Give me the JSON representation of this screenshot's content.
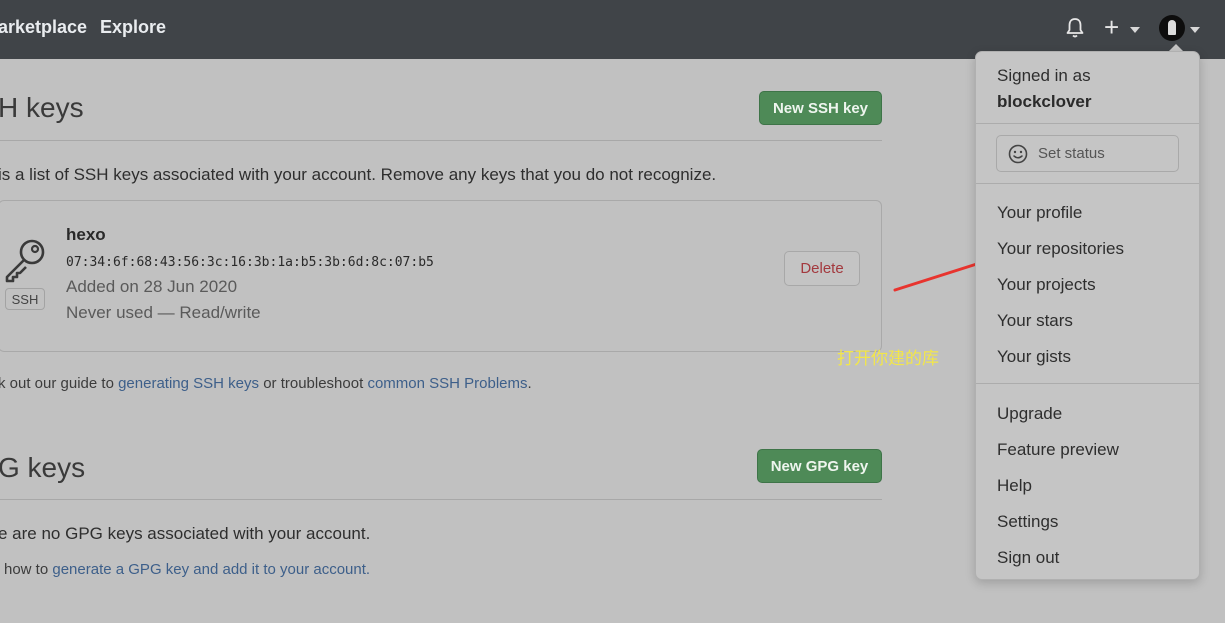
{
  "nav": {
    "marketplace": "arketplace",
    "explore": "Explore"
  },
  "ssh": {
    "heading": "H keys",
    "new_button": "New SSH key",
    "description": "is a list of SSH keys associated with your account. Remove any keys that you do not recognize.",
    "key": {
      "title": "hexo",
      "fingerprint": "07:34:6f:68:43:56:3c:16:3b:1a:b5:3b:6d:8c:07:b5",
      "added": "Added on 28 Jun 2020",
      "usage": "Never used — Read/write",
      "badge": "SSH",
      "delete_label": "Delete"
    },
    "guide_prefix": "k out our guide to",
    "guide_link1": "generating SSH keys",
    "guide_middle": "or troubleshoot",
    "guide_link2": "common SSH Problems",
    "guide_suffix": "."
  },
  "gpg": {
    "heading": "G keys",
    "new_button": "New GPG key",
    "empty_text": "e are no GPG keys associated with your account.",
    "learn_prefix": "how to",
    "learn_link": "generate a GPG key and add it to your account."
  },
  "dropdown": {
    "signed_in_label": "Signed in as",
    "username": "blockclover",
    "set_status": "Set status",
    "items": [
      "Your profile",
      "Your repositories",
      "Your projects",
      "Your stars",
      "Your gists"
    ],
    "items2": [
      "Upgrade",
      "Feature preview",
      "Help",
      "Settings",
      "Sign out"
    ]
  },
  "annotation": {
    "text": "打开你建的库"
  },
  "colors": {
    "topbar": "#404448",
    "green_button": "#4e8a57",
    "arrow": "#e8342e",
    "annotation": "#f2e64a",
    "link": "#3d5f8a"
  },
  "icons": {
    "notifications": "bell-icon",
    "create": "plus-icon",
    "key": "key-icon",
    "status": "smiley-icon"
  }
}
